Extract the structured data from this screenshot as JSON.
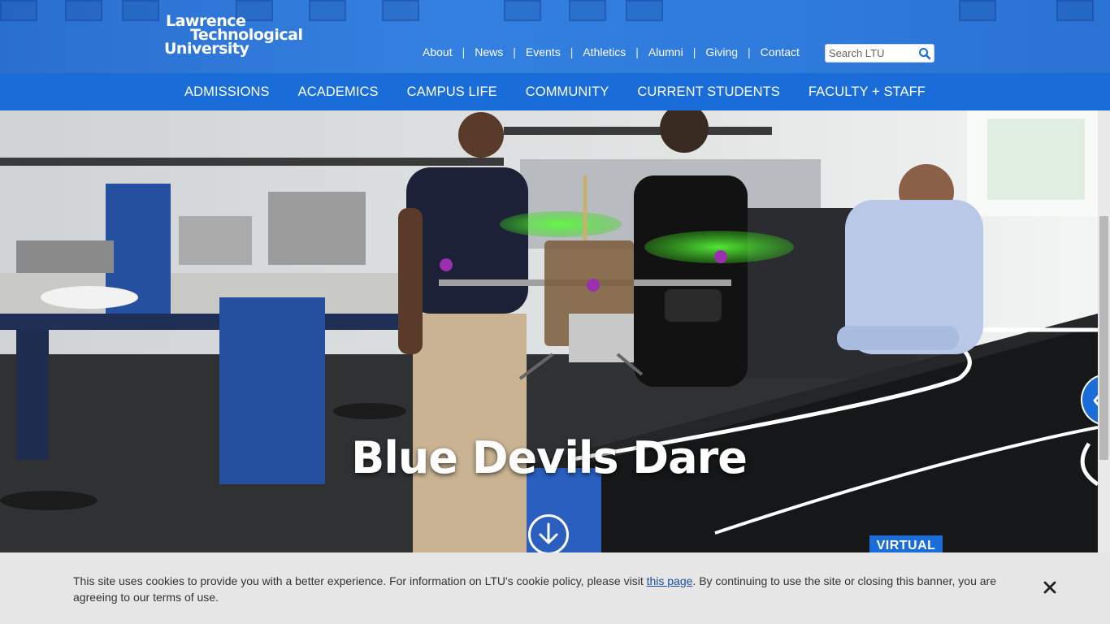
{
  "brand": {
    "logo_line1": "Lawrence",
    "logo_line2": "Technological",
    "logo_line3": "University",
    "primary_color": "#1a6cd9"
  },
  "utility_nav": {
    "items": [
      "About",
      "News",
      "Events",
      "Athletics",
      "Alumni",
      "Giving",
      "Contact"
    ],
    "separator": "|"
  },
  "search": {
    "placeholder": "Search LTU",
    "icon": "search-icon"
  },
  "main_nav": {
    "items": [
      "ADMISSIONS",
      "ACADEMICS",
      "CAMPUS LIFE",
      "COMMUNITY",
      "CURRENT STUDENTS",
      "FACULTY + STAFF"
    ]
  },
  "hero": {
    "title": "Blue Devils Dare",
    "scroll_icon": "arrow-down-circle-icon",
    "tag": "VIRTUAL",
    "side_tab_icon": "double-chevron-left-icon"
  },
  "cookie_banner": {
    "text_before": "This site uses cookies to provide you with a better experience. For information on LTU's cookie policy, please visit ",
    "link_text": "this page",
    "text_after": ". By continuing to use the site or closing this banner, you are agreeing to our terms of use.",
    "close_icon": "close-icon"
  }
}
